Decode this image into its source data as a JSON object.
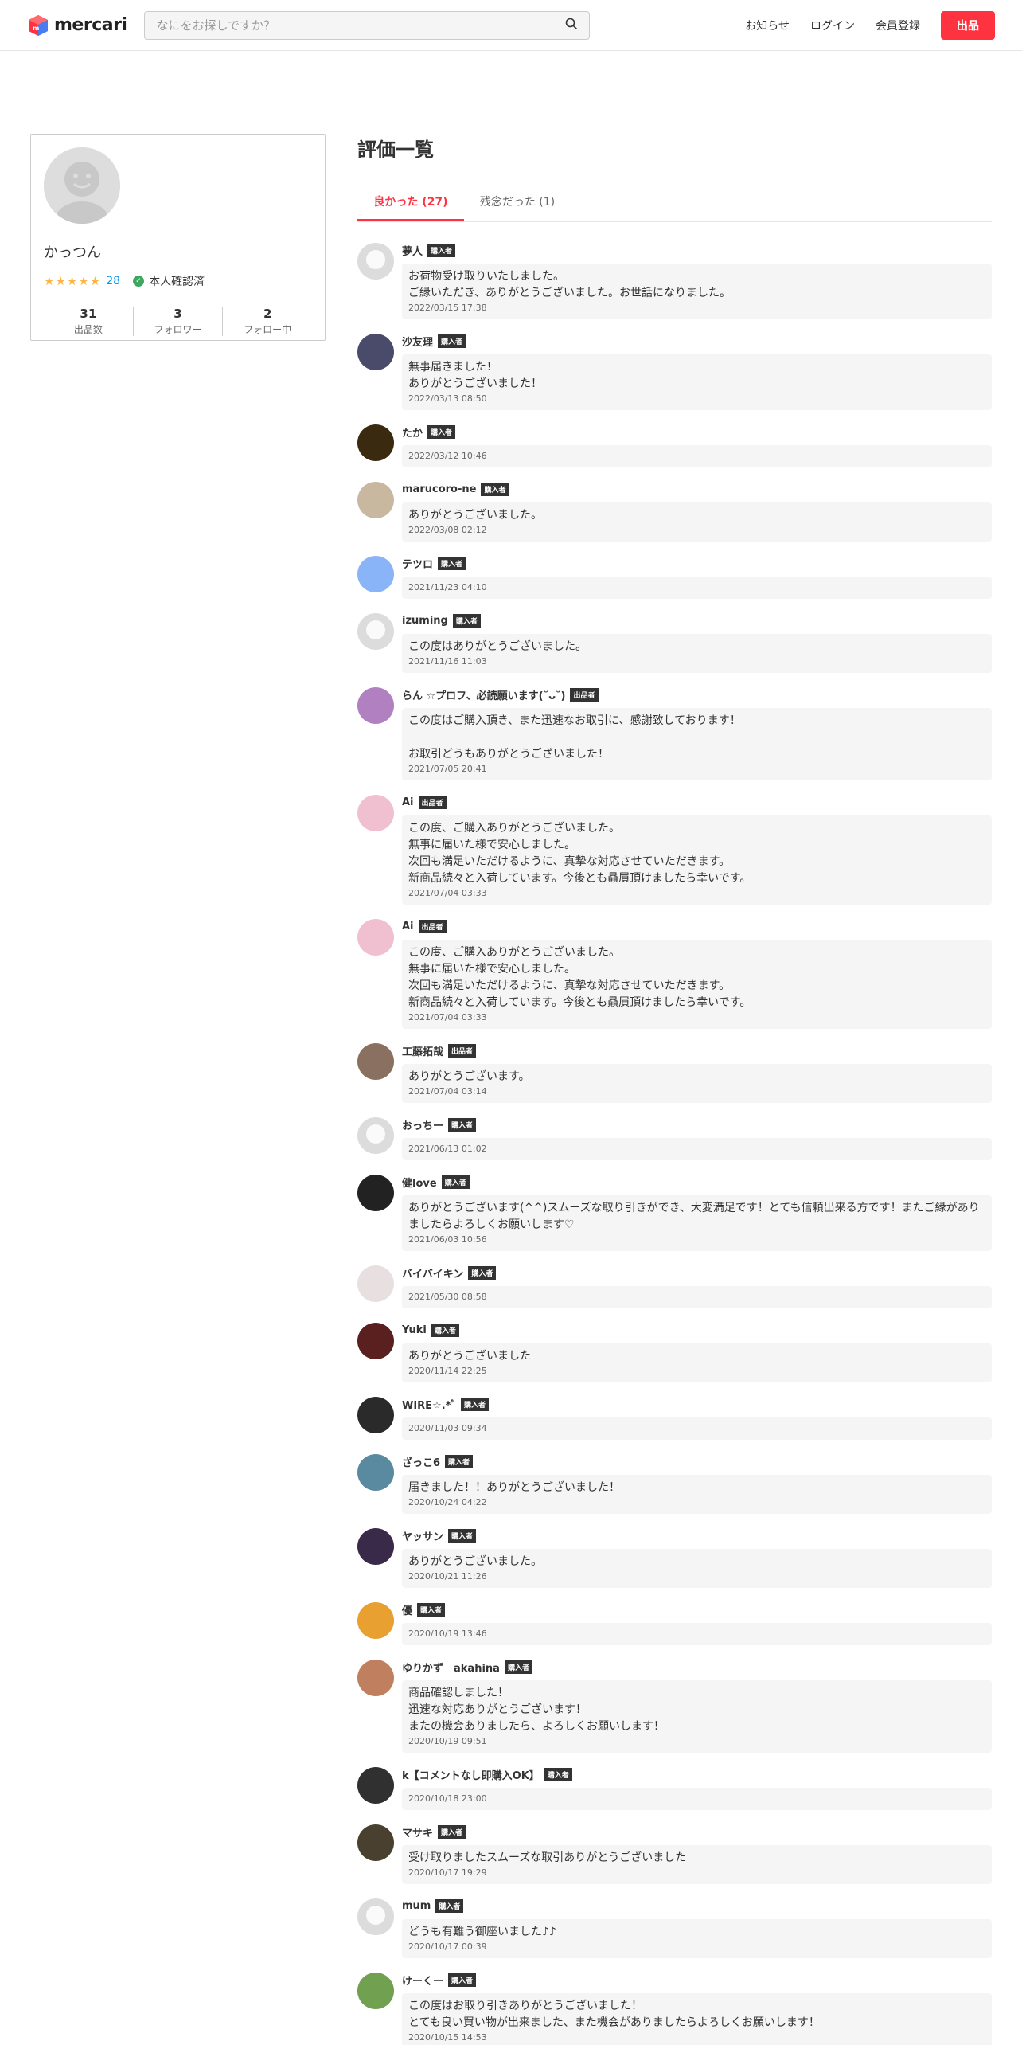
{
  "header": {
    "logo_text": "mercari",
    "search_placeholder": "なにをお探しですか？",
    "nav": {
      "news": "お知らせ",
      "login": "ログイン",
      "signup": "会員登録",
      "sell": "出品"
    }
  },
  "profile": {
    "name": "かっつん",
    "stars": "★★★★★",
    "rating_count": "28",
    "verified_label": "本人確認済",
    "stats": [
      {
        "num": "31",
        "label": "出品数"
      },
      {
        "num": "3",
        "label": "フォロワー"
      },
      {
        "num": "2",
        "label": "フォロー中"
      }
    ]
  },
  "page_title": "評価一覧",
  "tabs": [
    {
      "label": "良かった (27)",
      "active": true
    },
    {
      "label": "残念だった (1)",
      "active": false
    }
  ],
  "colors": {
    "accent": "#ff333f",
    "badge": "#333333",
    "bubble": "#f5f5f5"
  },
  "reviews": [
    {
      "name": "夢人",
      "badge": "購入者",
      "comment": "お荷物受け取りいたしました。\nご縁いただき、ありがとうございました。お世話になりました。",
      "date": "2022/03/15 17:38",
      "avatar_color": "#dcdcdc"
    },
    {
      "name": "沙友理",
      "badge": "購入者",
      "comment": "無事届きました！\nありがとうございました！",
      "date": "2022/03/13 08:50",
      "avatar_color": "#4a4a6a"
    },
    {
      "name": "たか",
      "badge": "購入者",
      "comment": "",
      "date": "2022/03/12 10:46",
      "avatar_color": "#3a2a10"
    },
    {
      "name": "marucoro-ne",
      "badge": "購入者",
      "comment": "ありがとうございました。",
      "date": "2022/03/08 02:12",
      "avatar_color": "#c9b8a0"
    },
    {
      "name": "テツロ",
      "badge": "購入者",
      "comment": "",
      "date": "2021/11/23 04:10",
      "avatar_color": "#8ab4f8"
    },
    {
      "name": "izuming",
      "badge": "購入者",
      "comment": "この度はありがとうございました。",
      "date": "2021/11/16 11:03",
      "avatar_color": "#dcdcdc"
    },
    {
      "name": "らん ☆プロフ、必読願います(˘ᴗ˘)",
      "badge": "出品者",
      "comment": "この度はご購入頂き、また迅速なお取引に、感謝致しております！\n\nお取引どうもありがとうございました！",
      "date": "2021/07/05 20:41",
      "avatar_color": "#b080c0"
    },
    {
      "name": "Ai",
      "badge": "出品者",
      "comment": "この度、ご購入ありがとうございました。\n無事に届いた様で安心しました。\n次回も満足いただけるように、真摯な対応させていただきます。\n新商品続々と入荷しています。今後とも贔屓頂けましたら幸いです。",
      "date": "2021/07/04 03:33",
      "avatar_color": "#f0c0d0"
    },
    {
      "name": "Ai",
      "badge": "出品者",
      "comment": "この度、ご購入ありがとうございました。\n無事に届いた様で安心しました。\n次回も満足いただけるように、真摯な対応させていただきます。\n新商品続々と入荷しています。今後とも贔屓頂けましたら幸いです。",
      "date": "2021/07/04 03:33",
      "avatar_color": "#f0c0d0"
    },
    {
      "name": "工藤拓哉",
      "badge": "出品者",
      "comment": "ありがとうございます。",
      "date": "2021/07/04 03:14",
      "avatar_color": "#8a7060"
    },
    {
      "name": "おっちー",
      "badge": "購入者",
      "comment": "",
      "date": "2021/06/13 01:02",
      "avatar_color": "#dcdcdc"
    },
    {
      "name": "健love",
      "badge": "購入者",
      "comment": "ありがとうございます(^^)スムーズな取り引きができ、大変満足です！とても信頼出来る方です！またご縁がありましたらよろしくお願いします♡",
      "date": "2021/06/03 10:56",
      "avatar_color": "#222222"
    },
    {
      "name": "バイバイキン",
      "badge": "購入者",
      "comment": "",
      "date": "2021/05/30 08:58",
      "avatar_color": "#e8e0e0"
    },
    {
      "name": "Yuki",
      "badge": "購入者",
      "comment": "ありがとうございました",
      "date": "2020/11/14 22:25",
      "avatar_color": "#5a2020"
    },
    {
      "name": "WIRE☆.*ﾟ",
      "badge": "購入者",
      "comment": "",
      "date": "2020/11/03 09:34",
      "avatar_color": "#2a2a2a"
    },
    {
      "name": "ざっこ6",
      "badge": "購入者",
      "comment": "届きました！！ありがとうございました！",
      "date": "2020/10/24 04:22",
      "avatar_color": "#5a8aa0"
    },
    {
      "name": "ヤッサン",
      "badge": "購入者",
      "comment": "ありがとうございました。",
      "date": "2020/10/21 11:26",
      "avatar_color": "#3a2a4a"
    },
    {
      "name": "優",
      "badge": "購入者",
      "comment": "",
      "date": "2020/10/19 13:46",
      "avatar_color": "#e8a030"
    },
    {
      "name": "ゆりかず　akahina",
      "badge": "購入者",
      "comment": "商品確認しました！\n迅速な対応ありがとうございます！\nまたの機会ありましたら、よろしくお願いします！",
      "date": "2020/10/19 09:51",
      "avatar_color": "#c08060"
    },
    {
      "name": "k【コメントなし即購入OK】",
      "badge": "購入者",
      "comment": "",
      "date": "2020/10/18 23:00",
      "avatar_color": "#303030"
    },
    {
      "name": "マサキ",
      "badge": "購入者",
      "comment": "受け取りましたスムーズな取引ありがとうございました",
      "date": "2020/10/17 19:29",
      "avatar_color": "#4a4030"
    },
    {
      "name": "mum",
      "badge": "購入者",
      "comment": "どうも有難う御座いました♪♪",
      "date": "2020/10/17 00:39",
      "avatar_color": "#dcdcdc"
    },
    {
      "name": "けーくー",
      "badge": "購入者",
      "comment": "この度はお取り引きありがとうございました！\nとても良い買い物が出来ました、また機会がありましたらよろしくお願いします！",
      "date": "2020/10/15 14:53",
      "avatar_color": "#70a050"
    }
  ]
}
